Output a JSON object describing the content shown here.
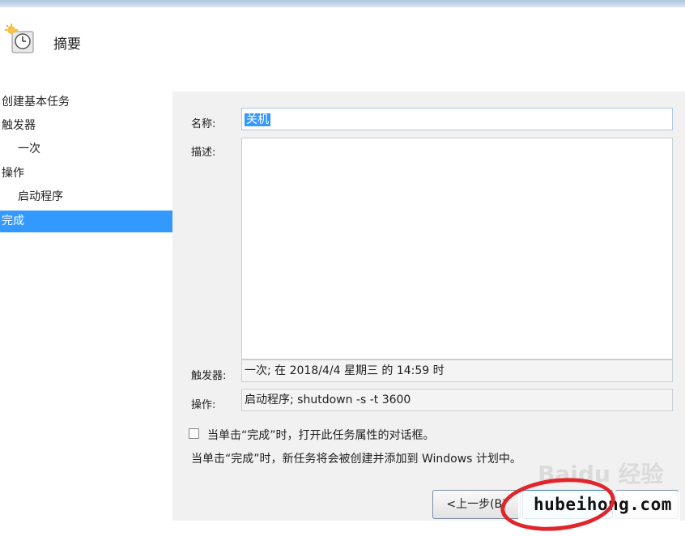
{
  "header": {
    "title": "摘要",
    "icon": "scheduled-task-icon"
  },
  "nav": {
    "items": [
      {
        "label": "创建基本任务"
      },
      {
        "label": "触发器"
      },
      {
        "label": "一次"
      },
      {
        "label": "操作"
      },
      {
        "label": "启动程序"
      },
      {
        "label": "完成"
      }
    ]
  },
  "form": {
    "name_label": "名称:",
    "name_value": "关机",
    "desc_label": "描述:",
    "desc_value": "",
    "trigger_label": "触发器:",
    "trigger_value": "一次; 在 2018/4/4 星期三 的 14:59 时",
    "action_label": "操作:",
    "action_value": "启动程序; shutdown -s -t 3600",
    "open_props_label": "当单击“完成”时，打开此任务属性的对话框。",
    "open_props_checked": false,
    "note": "当单击“完成”时，新任务将会被创建并添加到 Windows 计划中。"
  },
  "buttons": {
    "back": "<上一步(B)"
  },
  "watermark": {
    "site": "hubeihong.com",
    "baidu": "Baidu 经验"
  },
  "colors": {
    "selection": "#3399ff",
    "highlight_circle": "#e0252b"
  }
}
